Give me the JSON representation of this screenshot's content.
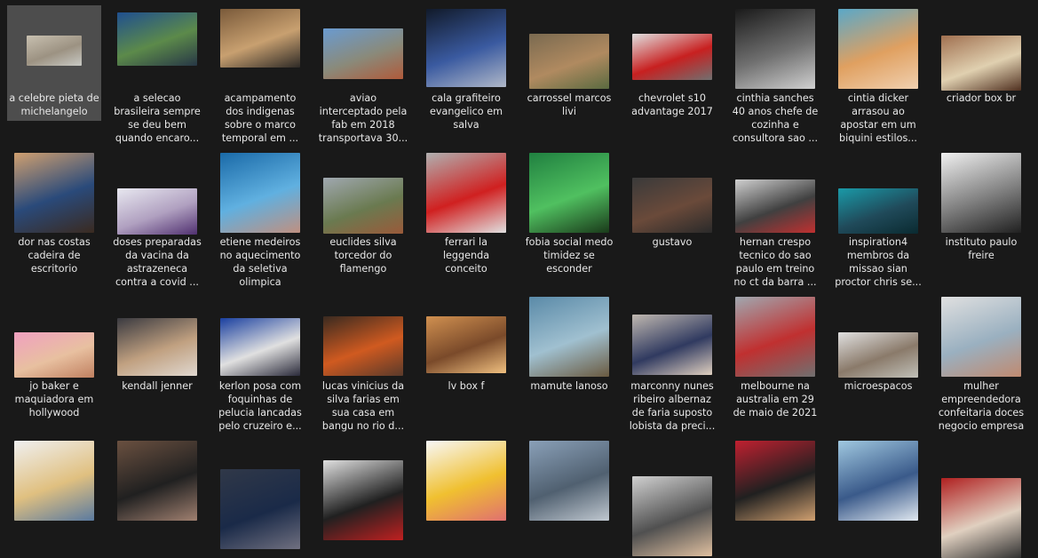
{
  "explorer": {
    "rows": [
      [
        {
          "name": "a celebre pieta de michelangelo",
          "icon": "image-icon",
          "selected": true,
          "colors": [
            "#c8c0b0",
            "#9c9282",
            "#c8c9c4"
          ]
        },
        {
          "name": "a selecao brasileira sempre se deu bem quando encaro...",
          "icon": "image-icon",
          "colors": [
            "#1f4f8f",
            "#5c8a4a",
            "#273746"
          ]
        },
        {
          "name": "acampamento dos indigenas sobre o marco temporal em ...",
          "icon": "image-icon",
          "colors": [
            "#7a5a3a",
            "#c8a070",
            "#2e2a26"
          ]
        },
        {
          "name": "aviao interceptado pela fab em 2018 transportava 30...",
          "icon": "image-icon",
          "colors": [
            "#6a9bd0",
            "#8a8a7a",
            "#b05a3a"
          ]
        },
        {
          "name": "cala grafiteiro evangelico em salva",
          "icon": "image-icon",
          "colors": [
            "#111a2a",
            "#3a5aa0",
            "#b0b8c8"
          ]
        },
        {
          "name": "carrossel marcos livi",
          "icon": "image-icon",
          "colors": [
            "#7a6a50",
            "#b08a60",
            "#5a6a40"
          ]
        },
        {
          "name": "chevrolet s10 advantage 2017",
          "icon": "image-icon",
          "colors": [
            "#e0e0e0",
            "#c82020",
            "#707070"
          ]
        },
        {
          "name": "cinthia sanches 40 anos chefe de cozinha e consultora sao ...",
          "icon": "image-icon",
          "colors": [
            "#1a1a1a",
            "#707070",
            "#d0d0d0"
          ]
        },
        {
          "name": "cintia dicker arrasou ao apostar em um biquini estilos...",
          "icon": "image-icon",
          "colors": [
            "#5aa8c8",
            "#e0a060",
            "#f0d0b0"
          ]
        },
        {
          "name": "criador box br",
          "icon": "image-icon",
          "colors": [
            "#a07050",
            "#e0d0b0",
            "#503020"
          ]
        }
      ],
      [
        {
          "name": "dor nas costas cadeira de escritorio",
          "icon": "image-icon",
          "colors": [
            "#d0a070",
            "#2a4a7a",
            "#3a2a20"
          ]
        },
        {
          "name": "doses preparadas da vacina da astrazeneca contra a covid ...",
          "icon": "image-icon",
          "colors": [
            "#e8e8f0",
            "#b0a0c0",
            "#503070"
          ]
        },
        {
          "name": "etiene medeiros no aquecimento da seletiva olimpica",
          "icon": "image-icon",
          "colors": [
            "#1a6aa8",
            "#60b0e0",
            "#c09080"
          ]
        },
        {
          "name": "euclides silva torcedor do flamengo",
          "icon": "image-icon",
          "colors": [
            "#a0a8b0",
            "#6a7a50",
            "#9a5a3a"
          ]
        },
        {
          "name": "ferrari la leggenda conceito",
          "icon": "image-icon",
          "colors": [
            "#b0b0b0",
            "#d02020",
            "#e0e0e0"
          ]
        },
        {
          "name": "fobia social medo timidez se esconder",
          "icon": "image-icon",
          "colors": [
            "#208040",
            "#50c060",
            "#1a3a1a"
          ]
        },
        {
          "name": "gustavo",
          "icon": "image-icon",
          "colors": [
            "#3a3a3a",
            "#6a4a3a",
            "#2a2a2a"
          ]
        },
        {
          "name": "hernan crespo tecnico do sao paulo em treino no ct da barra ...",
          "icon": "image-icon",
          "colors": [
            "#d0d0d0",
            "#404040",
            "#c03030"
          ]
        },
        {
          "name": "inspiration4 membros da missao sian proctor chris se...",
          "icon": "image-icon",
          "colors": [
            "#1a9aa8",
            "#204a5a",
            "#0a2a30"
          ]
        },
        {
          "name": "instituto paulo freire",
          "icon": "image-icon",
          "colors": [
            "#f0f0f0",
            "#808080",
            "#202020"
          ]
        }
      ],
      [
        {
          "name": "jo baker e maquiadora em hollywood",
          "icon": "image-icon",
          "colors": [
            "#f0a0c0",
            "#e8c0a0",
            "#c08060"
          ]
        },
        {
          "name": "kendall jenner",
          "icon": "image-icon",
          "colors": [
            "#3a3a40",
            "#c0a080",
            "#e0d8d0"
          ]
        },
        {
          "name": "kerlon posa com foquinhas de pelucia lancadas pelo cruzeiro e...",
          "icon": "image-icon",
          "colors": [
            "#1a40a0",
            "#e0e0e0",
            "#2a2a3a"
          ]
        },
        {
          "name": "lucas vinicius da silva farias em sua casa em bangu no rio d...",
          "icon": "image-icon",
          "colors": [
            "#3a2a20",
            "#d05a20",
            "#5a3a2a"
          ]
        },
        {
          "name": "lv box f",
          "icon": "image-icon",
          "colors": [
            "#d09050",
            "#7a4a2a",
            "#f0c080"
          ]
        },
        {
          "name": "mamute lanoso",
          "icon": "image-icon",
          "colors": [
            "#5a8aa8",
            "#a0c0d0",
            "#6a5a40"
          ]
        },
        {
          "name": "marconny nunes ribeiro albernaz de faria suposto lobista da preci...",
          "icon": "image-icon",
          "colors": [
            "#c0b8b0",
            "#303a60",
            "#e0d0c0"
          ]
        },
        {
          "name": "melbourne na australia em 29 de maio de 2021",
          "icon": "image-icon",
          "colors": [
            "#a0a8b0",
            "#c03030",
            "#707070"
          ]
        },
        {
          "name": "microespacos",
          "icon": "image-icon",
          "colors": [
            "#e0e0e0",
            "#8a7a6a",
            "#c0c0b8"
          ]
        },
        {
          "name": "mulher empreendedora confeitaria doces negocio empresa",
          "icon": "image-icon",
          "colors": [
            "#e0e0e0",
            "#9ab0c0",
            "#c08a70"
          ]
        }
      ],
      [
        {
          "name": "",
          "icon": "image-icon",
          "colors": [
            "#f0f0f0",
            "#e0c080",
            "#5a7aa0"
          ]
        },
        {
          "name": "",
          "icon": "image-icon",
          "colors": [
            "#6a5040",
            "#202020",
            "#a08070"
          ]
        },
        {
          "name": "",
          "icon": "image-icon",
          "colors": [
            "#303848",
            "#1a2a48",
            "#707080"
          ]
        },
        {
          "name": "",
          "icon": "image-icon",
          "colors": [
            "#e0e0e0",
            "#202020",
            "#c02020"
          ]
        },
        {
          "name": "",
          "icon": "image-icon",
          "colors": [
            "#f8f8f8",
            "#f0c030",
            "#e07070"
          ]
        },
        {
          "name": "",
          "icon": "image-icon",
          "colors": [
            "#8aa0b8",
            "#506070",
            "#c0c8d0"
          ]
        },
        {
          "name": "",
          "icon": "image-icon",
          "colors": [
            "#d0d0d0",
            "#505050",
            "#e0c0a0"
          ]
        },
        {
          "name": "",
          "icon": "image-icon",
          "colors": [
            "#c02030",
            "#202020",
            "#d0a070"
          ]
        },
        {
          "name": "",
          "icon": "image-icon",
          "colors": [
            "#a0c8e0",
            "#3a5a8a",
            "#e0e8f0"
          ]
        },
        {
          "name": "",
          "icon": "image-icon",
          "colors": [
            "#b02020",
            "#e0d0c0",
            "#303030"
          ]
        }
      ]
    ]
  }
}
